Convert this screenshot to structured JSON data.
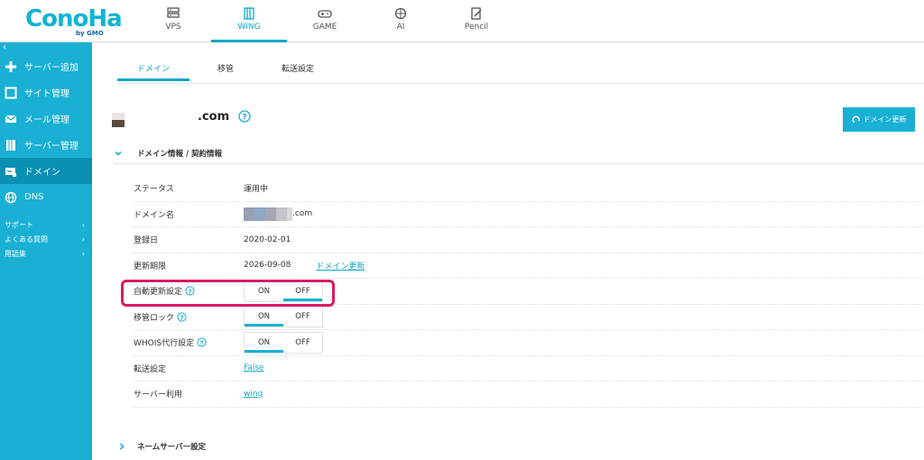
{
  "brand": {
    "logo_text": "ConoHa",
    "logo_sub": "by GMO",
    "logo_color": "#0fb4d4"
  },
  "topnav": [
    {
      "label": "VPS",
      "icon": "server-icon",
      "active": false
    },
    {
      "label": "WING",
      "icon": "book-icon",
      "active": true
    },
    {
      "label": "GAME",
      "icon": "gamepad-icon",
      "active": false
    },
    {
      "label": "AI",
      "icon": "brain-icon",
      "active": false
    },
    {
      "label": "Pencil",
      "icon": "pencil-icon",
      "active": false
    }
  ],
  "sidebar": {
    "collapse": "‹",
    "items": [
      {
        "label": "サーバー追加",
        "icon": "plus-icon",
        "active": false
      },
      {
        "label": "サイト管理",
        "icon": "square-icon",
        "active": false
      },
      {
        "label": "メール管理",
        "icon": "mail-icon",
        "active": false
      },
      {
        "label": "サーバー管理",
        "icon": "server-manage-icon",
        "active": false
      },
      {
        "label": "ドメイン",
        "icon": "domain-icon",
        "active": true
      },
      {
        "label": "DNS",
        "icon": "globe-icon",
        "active": false
      }
    ],
    "links": [
      {
        "label": "サポート"
      },
      {
        "label": "よくある質問"
      },
      {
        "label": "用語集"
      }
    ]
  },
  "tabs": [
    {
      "label": "ドメイン",
      "active": true
    },
    {
      "label": "移管",
      "active": false
    },
    {
      "label": "転送設定",
      "active": false
    }
  ],
  "domain": {
    "suffix": ".com",
    "renew_button": "ドメイン更新"
  },
  "section": {
    "title": "ドメイン情報 / 契約情報"
  },
  "rows": {
    "status": {
      "label": "ステータス",
      "value": "運用中"
    },
    "domain_name": {
      "label": "ドメイン名",
      "value": ".com"
    },
    "registered": {
      "label": "登録日",
      "value": "2020-02-01"
    },
    "expiry": {
      "label": "更新期限",
      "value": "2026-09-08",
      "link": "ドメイン更新"
    },
    "auto_renew": {
      "label": "自動更新設定",
      "on": "ON",
      "off": "OFF",
      "selected": "OFF"
    },
    "transfer_lock": {
      "label": "移管ロック",
      "on": "ON",
      "off": "OFF",
      "selected": "ON"
    },
    "whois": {
      "label": "WHOIS代行設定",
      "on": "ON",
      "off": "OFF",
      "selected": "ON"
    },
    "forwarding": {
      "label": "転送設定",
      "value": "False"
    },
    "server_use": {
      "label": "サーバー利用",
      "value": "wing"
    }
  },
  "nameserver_section": {
    "title": "ネームサーバー設定"
  },
  "colors": {
    "accent": "#19b0d4",
    "highlight": "#d81b60",
    "active_side": "#0b8fb3"
  }
}
